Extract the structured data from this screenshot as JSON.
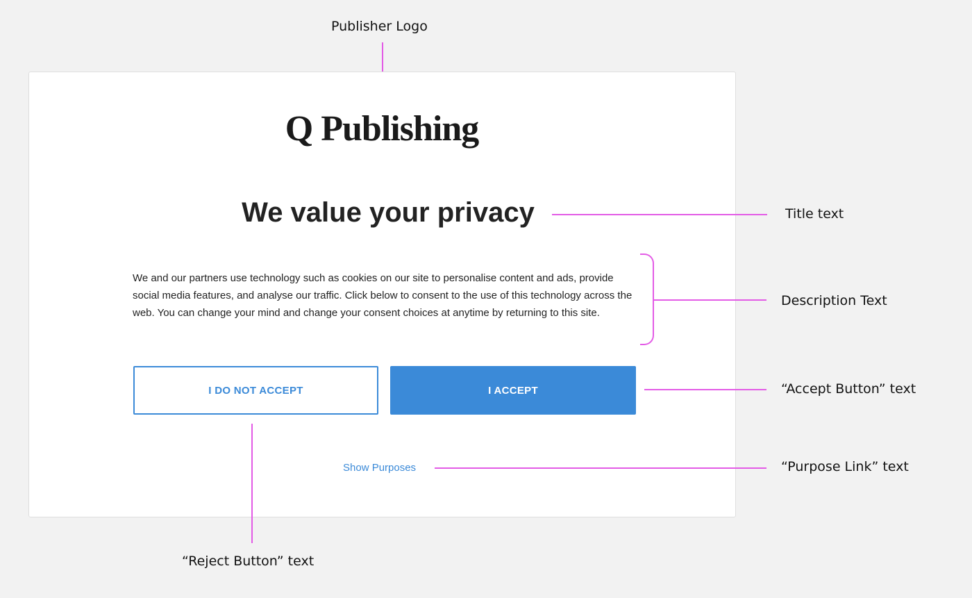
{
  "annotations": {
    "publisher_logo": "Publisher Logo",
    "title_text": "Title text",
    "description_text": "Description Text",
    "accept_button_text": "“Accept Button” text",
    "purpose_link_text": "“Purpose Link” text",
    "reject_button_text": "“Reject Button” text"
  },
  "dialog": {
    "logo": "Q Publishing",
    "title": "We value your privacy",
    "description": "We and our partners use technology such as cookies on our site to personalise content and ads, provide social media features, and analyse our traffic. Click below to consent to the use of this technology across the web. You can change your mind and change your consent choices at anytime by returning to this site.",
    "reject_label": "I DO NOT ACCEPT",
    "accept_label": "I ACCEPT",
    "purposes_link": "Show Purposes"
  },
  "colors": {
    "accent": "#3b8ad8",
    "annotation_line": "#e35be6",
    "background": "#f2f2f2"
  }
}
